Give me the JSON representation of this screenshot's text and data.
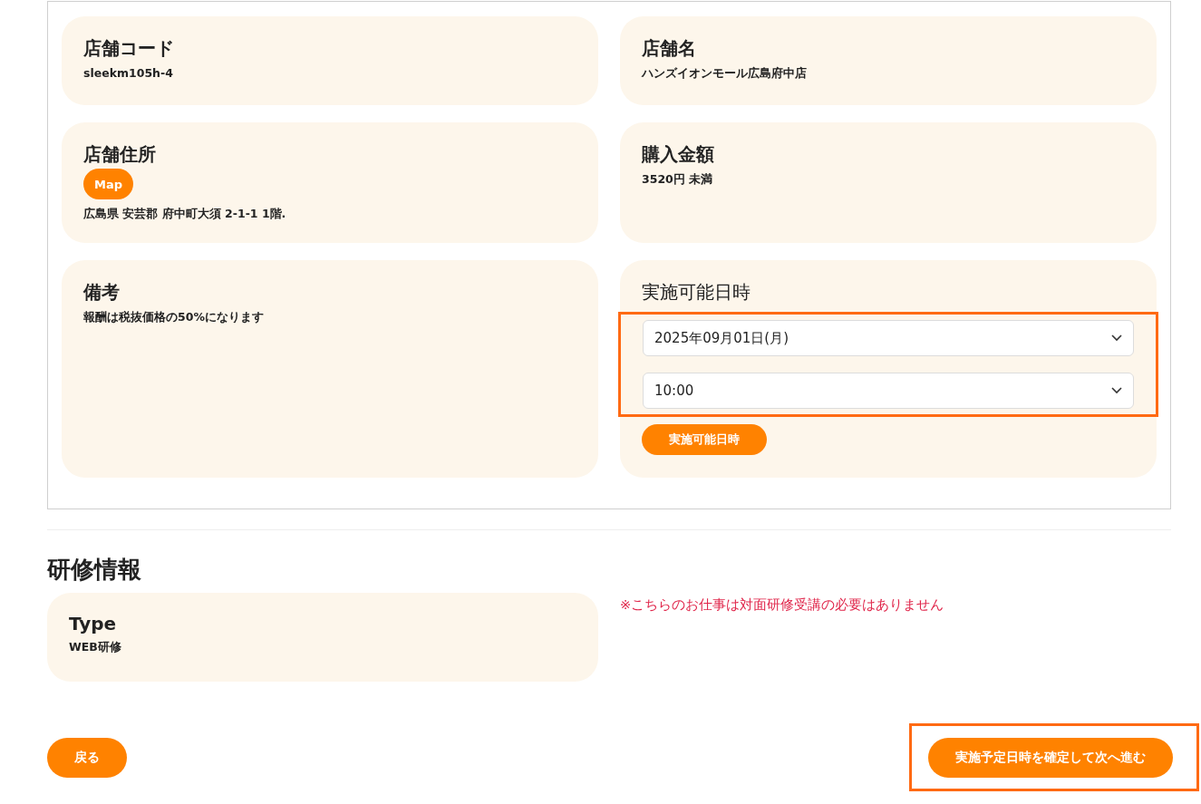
{
  "store_cards": [
    {
      "kind": "text",
      "title": "店舗コード",
      "value": "sleekm105h-4"
    },
    {
      "kind": "text",
      "title": "店舗名",
      "value": "ハンズイオンモール広島府中店"
    },
    {
      "kind": "address",
      "title": "店舗住所",
      "map_button": "Map",
      "value": "広島県 安芸郡 府中町大須 2-1-1 1階."
    },
    {
      "kind": "text",
      "title": "購入金額",
      "value": "3520円 未満"
    },
    {
      "kind": "text",
      "title": "備考",
      "value": "報酬は税抜価格の50%になります"
    },
    {
      "kind": "schedule",
      "title": "実施可能日時",
      "highlighted": true,
      "selects": [
        {
          "value": "2025年09月01日(月)"
        },
        {
          "value": "10:00"
        }
      ],
      "button": "実施可能日時"
    }
  ],
  "training": {
    "heading": "研修情報",
    "card": {
      "title": "Type",
      "value": "WEB研修"
    },
    "note": "※こちらのお仕事は対面研修受講の必要はありません"
  },
  "footer": {
    "back_button": "戻る",
    "submit_button": {
      "label": "実施予定日時を確定して次へ進む",
      "highlighted": true
    }
  }
}
